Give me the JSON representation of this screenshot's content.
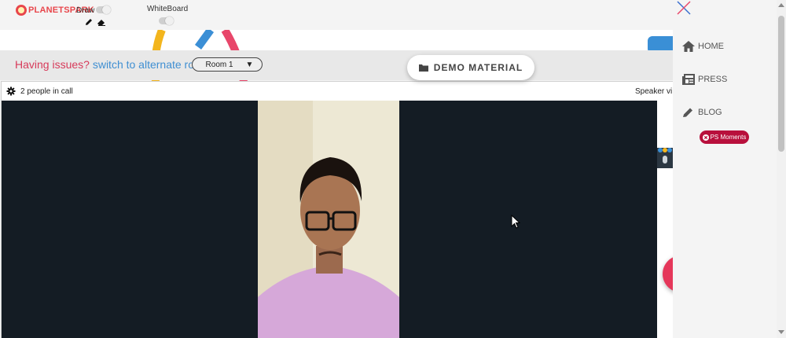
{
  "toolbar": {
    "logo_text_a": "PLANET",
    "logo_text_b": "SPARK",
    "draw_label": "Draw",
    "whiteboard_label": "WhiteBoard",
    "draw_toggle_on": false,
    "whiteboard_toggle_on": false
  },
  "issues": {
    "question": "Having issues?",
    "link": "switch to alternate room",
    "room_selected": "Room 1"
  },
  "demo_material": {
    "label": "DEMO MATERIAL",
    "icon": "folder-icon"
  },
  "call": {
    "people_count": "2 people in call",
    "view_mode": "Speaker vi"
  },
  "sidebar": {
    "items": [
      {
        "label": "HOME",
        "icon": "home-icon"
      },
      {
        "label": "PRESS",
        "icon": "newspaper-icon"
      },
      {
        "label": "BLOG",
        "icon": "pencil-icon"
      }
    ],
    "badge": "PS Moments"
  },
  "colors": {
    "accent_red": "#e5375a",
    "link_blue": "#3f8fd2",
    "badge_red": "#b8103c",
    "video_bg": "#141c24"
  }
}
